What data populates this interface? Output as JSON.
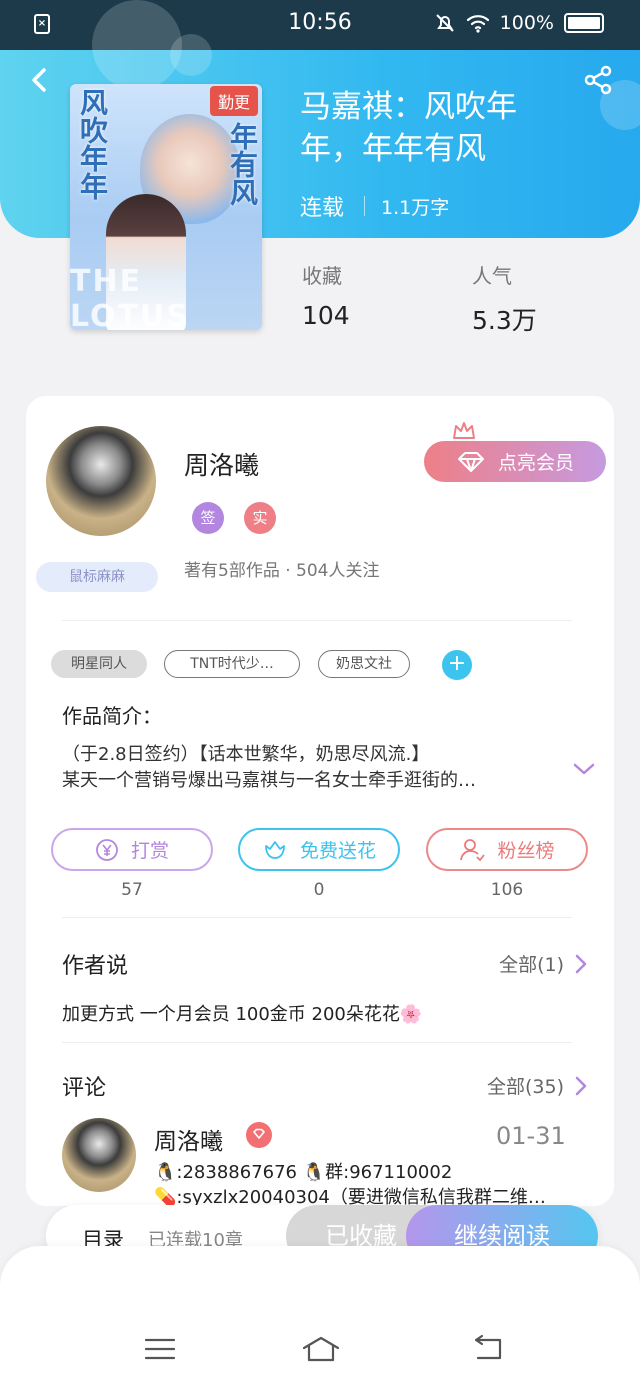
{
  "status_bar": {
    "time": "10:56",
    "battery": "100%"
  },
  "book": {
    "title": "马嘉祺：风吹年年，年年有风",
    "cover_badge": "勤更",
    "cover_vertical_1": "风吹年年",
    "cover_vertical_2": "年有风",
    "status": "连载",
    "word_count": "1.1万字",
    "favorites_label": "收藏",
    "favorites_value": "104",
    "popularity_label": "人气",
    "popularity_value": "5.3万"
  },
  "author": {
    "name": "周洛曦",
    "badge_sign": "签",
    "badge_real": "实",
    "stats": "著有5部作品 · 504人关注",
    "nickname_tag": "鼠标麻麻",
    "vip_button": "点亮会员"
  },
  "tags": [
    "明星同人",
    "TNT时代少…",
    "奶思文社"
  ],
  "intro": {
    "heading": "作品简介：",
    "line1": "（于2.8日签约）【话本世繁华，奶思尽风流.】",
    "line2": "某天一个营销号爆出马嘉祺与一名女士牵手逛街的…"
  },
  "actions": [
    {
      "label": "打赏",
      "count": "57"
    },
    {
      "label": "免费送花",
      "count": "0"
    },
    {
      "label": "粉丝榜",
      "count": "106"
    }
  ],
  "author_says": {
    "title": "作者说",
    "more": "全部(1)",
    "text": "加更方式 一个月会员 100金币 200朵花花🌸"
  },
  "comments": {
    "title": "评论",
    "more": "全部(35)",
    "first": {
      "name": "周洛曦",
      "date": "01-31",
      "line1": "🐧:2838867676 🐧群:967110002",
      "line2": "💊:syxzlx20040304（要进微信私信我群二维…"
    }
  },
  "bottom": {
    "toc": "目录",
    "toc_sub": "已连载10章",
    "collected": "已收藏",
    "continue_reading": "继续阅读"
  },
  "colors": {
    "accent": "#32b8f0",
    "vip": "#ee7f87",
    "reward": "#b387e0",
    "flower": "#3cc3ee",
    "fans": "#ec7a7a"
  }
}
